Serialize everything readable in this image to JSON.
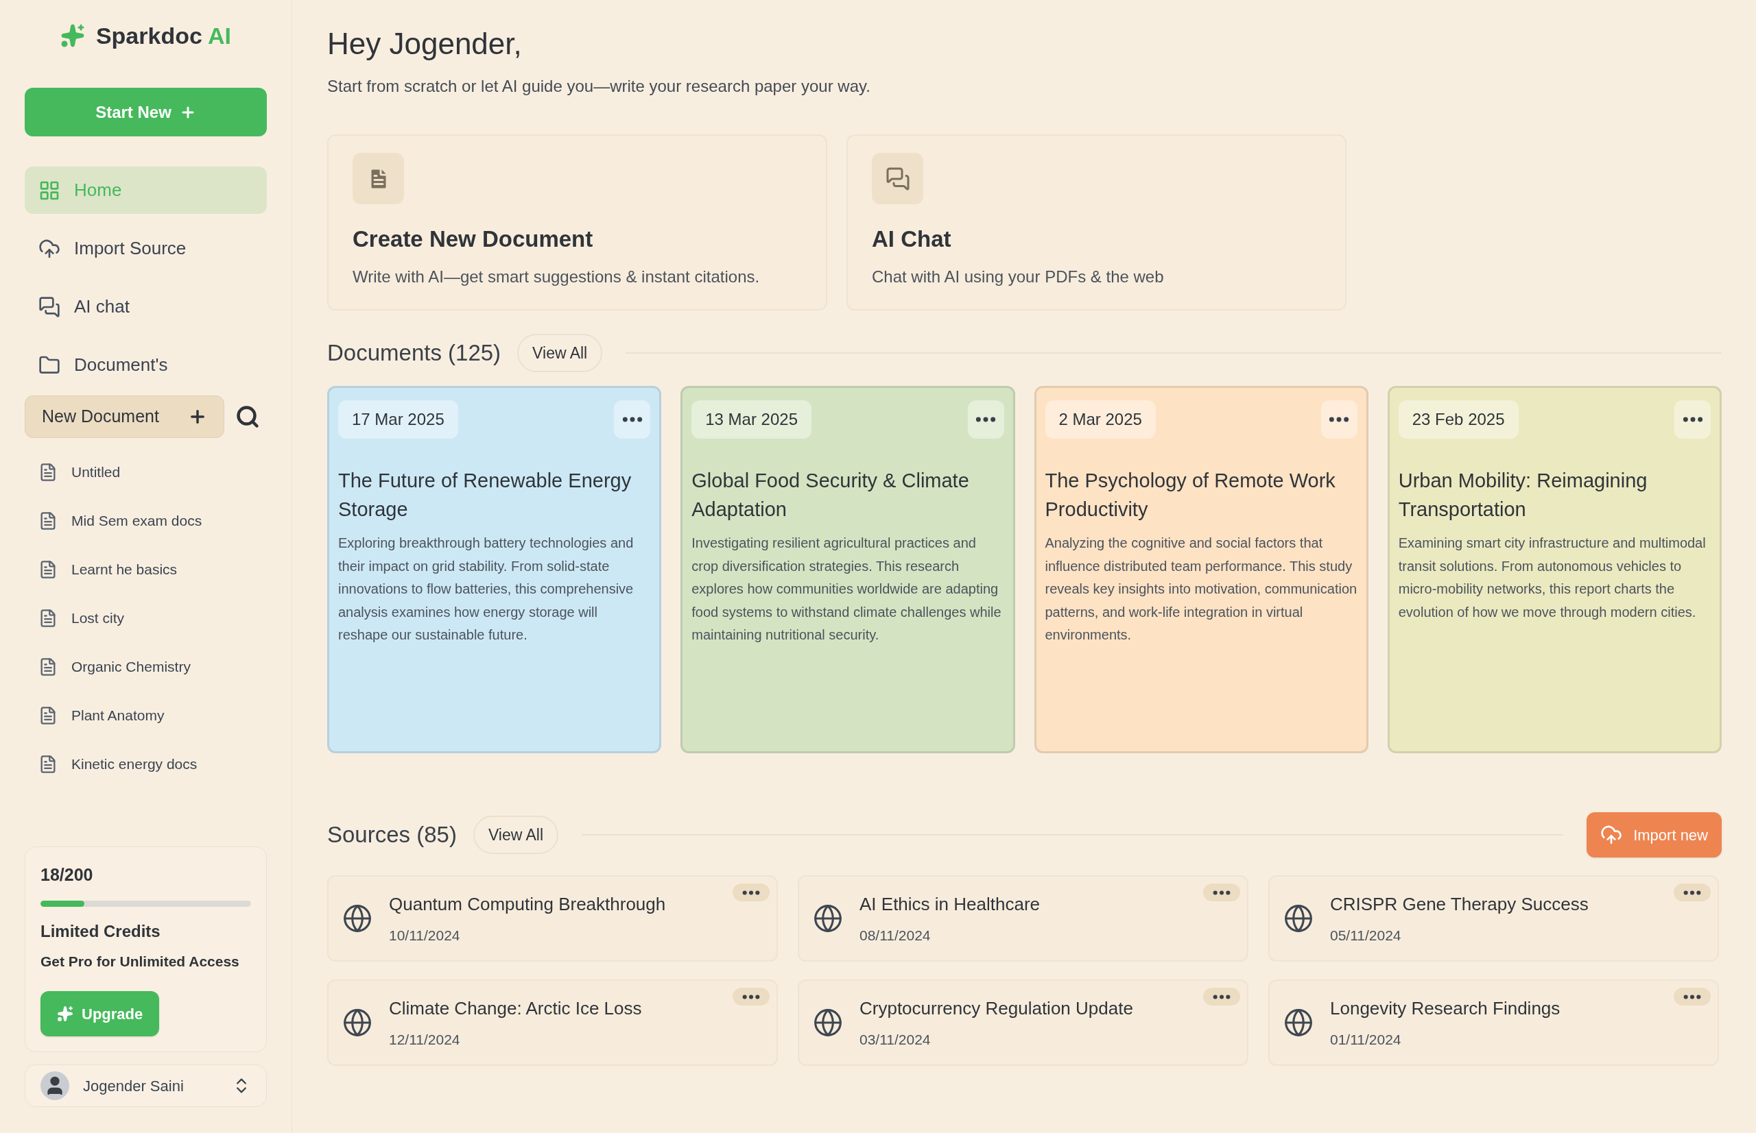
{
  "brand": {
    "name": "Sparkdoc",
    "accent": "AI"
  },
  "start_button": "Start New",
  "nav": [
    {
      "label": "Home",
      "selected": true
    },
    {
      "label": "Import Source",
      "selected": false
    },
    {
      "label": "AI chat",
      "selected": false
    },
    {
      "label": "Document's",
      "selected": false
    }
  ],
  "new_document": "New Document",
  "doc_list": [
    "Untitled",
    "Mid Sem exam docs",
    "Learnt he basics",
    "Lost city",
    "Organic Chemistry",
    "Plant Anatomy",
    "Kinetic energy docs"
  ],
  "credits": {
    "count": "18/200",
    "level": 0.21,
    "title": "Limited Credits",
    "subtitle": "Get Pro for Unlimited Access",
    "button": "Upgrade"
  },
  "user": {
    "name": "Jogender Saini"
  },
  "greeting": "Hey Jogender,",
  "intro": "Start from scratch or let AI guide you—write your research paper your way.",
  "actions": [
    {
      "title": "Create New Document",
      "description": "Write with AI—get smart suggestions & instant citations."
    },
    {
      "title": "AI Chat",
      "description": "Chat with AI using your PDFs & the web"
    }
  ],
  "documents": {
    "heading": "Documents (125)",
    "view_all": "View All",
    "items": [
      {
        "date": "17 Mar 2025",
        "title": "The Future of Renewable Energy Storage",
        "summary": "Exploring breakthrough battery technologies and their impact on grid stability. From solid-state innovations to flow batteries, this comprehensive analysis examines how energy storage will reshape our sustainable future.",
        "color": "#cde8f5"
      },
      {
        "date": "13 Mar 2025",
        "title": "Global Food Security & Climate Adaptation",
        "summary": "Investigating resilient agricultural practices and crop diversification strategies. This research explores how communities worldwide are adapting food systems to withstand climate challenges while maintaining nutritional security.",
        "color": "#d4e4c2"
      },
      {
        "date": "2 Mar 2025",
        "title": "The Psychology of Remote Work Productivity",
        "summary": "Analyzing the cognitive and social factors that influence distributed team performance. This study reveals key insights into motivation, communication patterns, and work-life integration in virtual environments.",
        "color": "#fde2c4"
      },
      {
        "date": "23 Feb 2025",
        "title": "Urban Mobility: Reimagining Transportation",
        "summary": "Examining smart city infrastructure and multimodal transit solutions. From autonomous vehicles to micro-mobility networks, this report charts the evolution of how we move through modern cities.",
        "color": "#ebe9c0"
      }
    ]
  },
  "sources": {
    "heading": "Sources (85)",
    "view_all": "View All",
    "import_button": "Import new",
    "items": [
      {
        "title": "Quantum Computing Breakthrough",
        "date": "10/11/2024"
      },
      {
        "title": "AI Ethics in Healthcare",
        "date": "08/11/2024"
      },
      {
        "title": "CRISPR Gene Therapy Success",
        "date": "05/11/2024"
      },
      {
        "title": "Climate Change: Arctic Ice Loss",
        "date": "12/11/2024"
      },
      {
        "title": "Cryptocurrency Regulation Update",
        "date": "03/11/2024"
      },
      {
        "title": "Longevity Research Findings",
        "date": "01/11/2024"
      }
    ]
  }
}
